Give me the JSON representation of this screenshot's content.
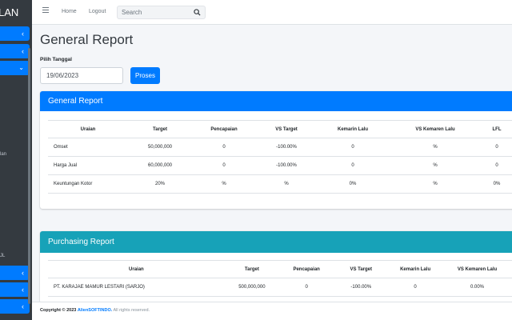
{
  "sidebar": {
    "brand": "LAN",
    "text1": "lan",
    "text2": "JL"
  },
  "navbar": {
    "home": "Home",
    "logout": "Logout",
    "search_placeholder": "Search"
  },
  "page": {
    "title": "General Report",
    "date_label": "Pilih Tanggal",
    "date_value": "19/06/2023",
    "proses_label": "Proses"
  },
  "general_report": {
    "title": "General Report",
    "headers": [
      "Uraian",
      "Target",
      "Pencapaian",
      "VS Target",
      "Kemarin Lalu",
      "VS Kemaren Lalu",
      "LFL"
    ],
    "rows": [
      [
        "Omset",
        "50,000,000",
        "0",
        "-100.00%",
        "0",
        "%",
        "0"
      ],
      [
        "Harga Jual",
        "60,000,000",
        "0",
        "-100.00%",
        "0",
        "%",
        "0"
      ],
      [
        "Keuntungan Kotor",
        "20%",
        "%",
        "%",
        "0%",
        "%",
        "0%"
      ]
    ]
  },
  "purchasing_report": {
    "title": "Purchasing Report",
    "headers": [
      "Uraian",
      "Target",
      "Pencapaian",
      "VS Target",
      "Kemarin Lalu",
      "VS Kemaren Lalu"
    ],
    "rows": [
      [
        "PT. KARAJAE MAMUR LESTARI (SARJO)",
        "500,000,000",
        "0",
        "-100.00%",
        "0",
        "0.00%"
      ]
    ]
  },
  "footer": {
    "copyright": "Copyright © 2023",
    "brand": "AlienSOFTINDO.",
    "rights": "All rights reserved."
  },
  "colors": {
    "primary": "#007bff",
    "info": "#17a2b8",
    "sidebar": "#343a40"
  }
}
